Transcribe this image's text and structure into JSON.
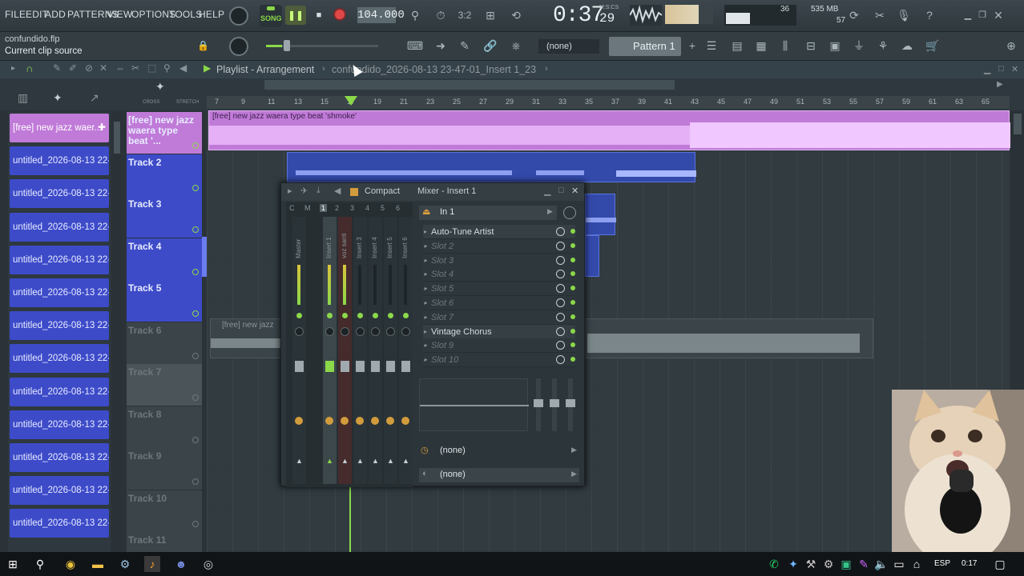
{
  "menu": [
    "FILE",
    "EDIT",
    "ADD",
    "PATTERNS",
    "VIEW",
    "OPTIONS",
    "TOOLS",
    "HELP"
  ],
  "transport": {
    "mode": "SONG",
    "tempo": "104.000",
    "time": "0:37",
    "time_small": "29",
    "time_unit": "M:S:CS"
  },
  "meters": {
    "cpu": "36",
    "mem": "535 MB",
    "poly": "57"
  },
  "hint": {
    "file": "confundido.flp",
    "text": "Current clip source"
  },
  "pattern": {
    "none": "(none)",
    "label": "Pattern 1"
  },
  "playlist": {
    "title": "Playlist - Arrangement",
    "crumb": "confundido_2026-08-13 23-47-01_Insert 1_23"
  },
  "ruler": [
    "7",
    "9",
    "11",
    "13",
    "15",
    "17",
    "19",
    "21",
    "23",
    "25",
    "27",
    "29",
    "31",
    "33",
    "35",
    "37",
    "39",
    "41",
    "43",
    "45",
    "47",
    "49",
    "51",
    "53",
    "55",
    "57",
    "59",
    "61",
    "63",
    "65"
  ],
  "picker": [
    "[free] new jazz  waer...",
    "untitled_2026-08-13 22-...",
    "untitled_2026-08-13 22-...",
    "untitled_2026-08-13 22-...",
    "untitled_2026-08-13 22-...",
    "untitled_2026-08-13 22-...",
    "untitled_2026-08-13 22-...",
    "untitled_2026-08-13 22-...",
    "untitled_2026-08-13 22-...",
    "untitled_2026-08-13 22-...",
    "untitled_2026-08-13 22-...",
    "untitled_2026-08-13 22-...",
    "untitled_2026-08-13 22-..."
  ],
  "tracks": [
    "[free] new jazz\nwaera type beat '...",
    "Track 2",
    "Track 3",
    "Track 4",
    "Track 5",
    "Track 6",
    "Track 7",
    "Track 8",
    "Track 9",
    "Track 10",
    "Track 11"
  ],
  "clip1": "[free] new jazz  waera type beat  'shmoke'",
  "clip6": "[free] new jazz",
  "mixer": {
    "compact": "Compact",
    "title": "Mixer - Insert 1",
    "input": "In 1",
    "strips": [
      "Master",
      "Insert 1",
      "voz santi",
      "Insert 3",
      "Insert 4",
      "Insert 5",
      "Insert 6"
    ],
    "headers": [
      "C",
      "M",
      "1",
      "2",
      "3",
      "4",
      "5",
      "6"
    ],
    "slots": [
      "Auto-Tune Artist",
      "Slot 2",
      "Slot 3",
      "Slot 4",
      "Slot 5",
      "Slot 6",
      "Slot 7",
      "Vintage Chorus",
      "Slot 9",
      "Slot 10"
    ],
    "out1": "(none)",
    "out2": "(none)"
  },
  "taskbar": {
    "lang": "ESP",
    "clock": "0:17"
  },
  "colors": {
    "clip_purple": "#c07ad8",
    "track_blue": "#3d4bc9",
    "accent_green": "#8bd84a"
  }
}
